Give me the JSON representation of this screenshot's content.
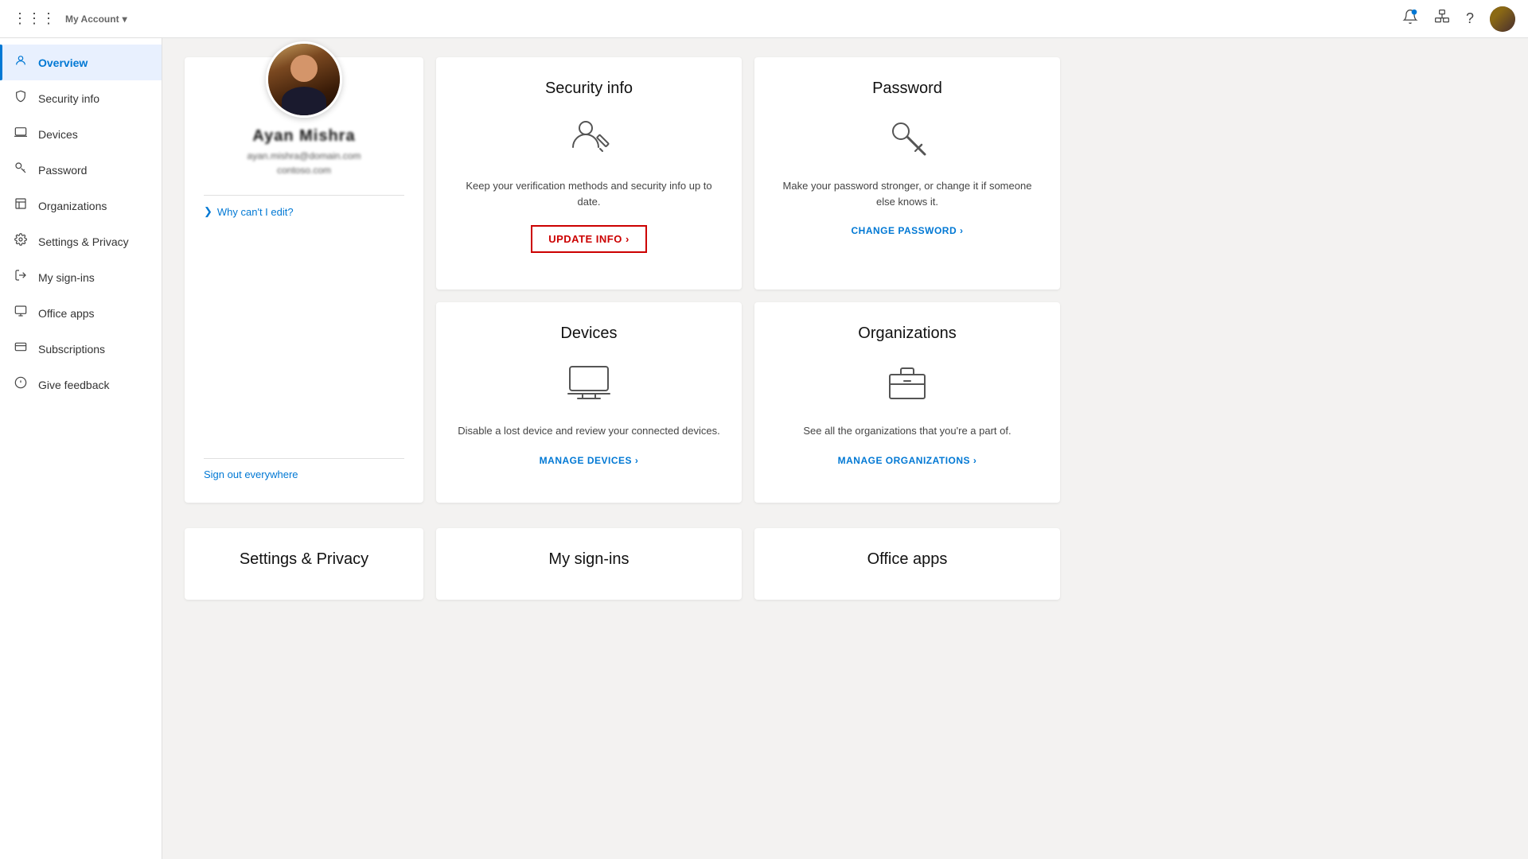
{
  "topnav": {
    "title": "My Account",
    "chevron": "▾",
    "icons": {
      "waffle": "⊞",
      "notification": "🔔",
      "org": "🏢",
      "help": "?"
    }
  },
  "sidebar": {
    "items": [
      {
        "id": "overview",
        "label": "Overview",
        "icon": "person",
        "active": true
      },
      {
        "id": "security-info",
        "label": "Security info",
        "icon": "shield"
      },
      {
        "id": "devices",
        "label": "Devices",
        "icon": "laptop"
      },
      {
        "id": "password",
        "label": "Password",
        "icon": "key"
      },
      {
        "id": "organizations",
        "label": "Organizations",
        "icon": "building"
      },
      {
        "id": "settings-privacy",
        "label": "Settings & Privacy",
        "icon": "settings"
      },
      {
        "id": "my-sign-ins",
        "label": "My sign-ins",
        "icon": "signin"
      },
      {
        "id": "office-apps",
        "label": "Office apps",
        "icon": "office"
      },
      {
        "id": "subscriptions",
        "label": "Subscriptions",
        "icon": "subscription"
      },
      {
        "id": "give-feedback",
        "label": "Give feedback",
        "icon": "feedback"
      }
    ]
  },
  "profile": {
    "name": "Ayan Mishra",
    "email": "ayan.mishra@domain.com",
    "domain": "contoso.com",
    "why_cant_edit": "Why can't I edit?",
    "sign_out_everywhere": "Sign out everywhere"
  },
  "cards": {
    "security_info": {
      "title": "Security info",
      "description": "Keep your verification methods and security info up to date.",
      "update_btn": "UPDATE INFO ›"
    },
    "password": {
      "title": "Password",
      "description": "Make your password stronger, or change it if someone else knows it.",
      "link": "CHANGE PASSWORD ›"
    },
    "devices": {
      "title": "Devices",
      "description": "Disable a lost device and review your connected devices.",
      "link": "MANAGE DEVICES ›"
    },
    "organizations": {
      "title": "Organizations",
      "description": "See all the organizations that you're a part of.",
      "link": "MANAGE ORGANIZATIONS ›"
    },
    "settings_privacy": {
      "title": "Settings & Privacy"
    },
    "my_sign_ins": {
      "title": "My sign-ins"
    },
    "office_apps": {
      "title": "Office apps"
    }
  },
  "colors": {
    "accent": "#0078d4",
    "danger": "#c00000",
    "text_primary": "#111111",
    "text_secondary": "#444444",
    "sidebar_active_bg": "#e8f4ff"
  }
}
